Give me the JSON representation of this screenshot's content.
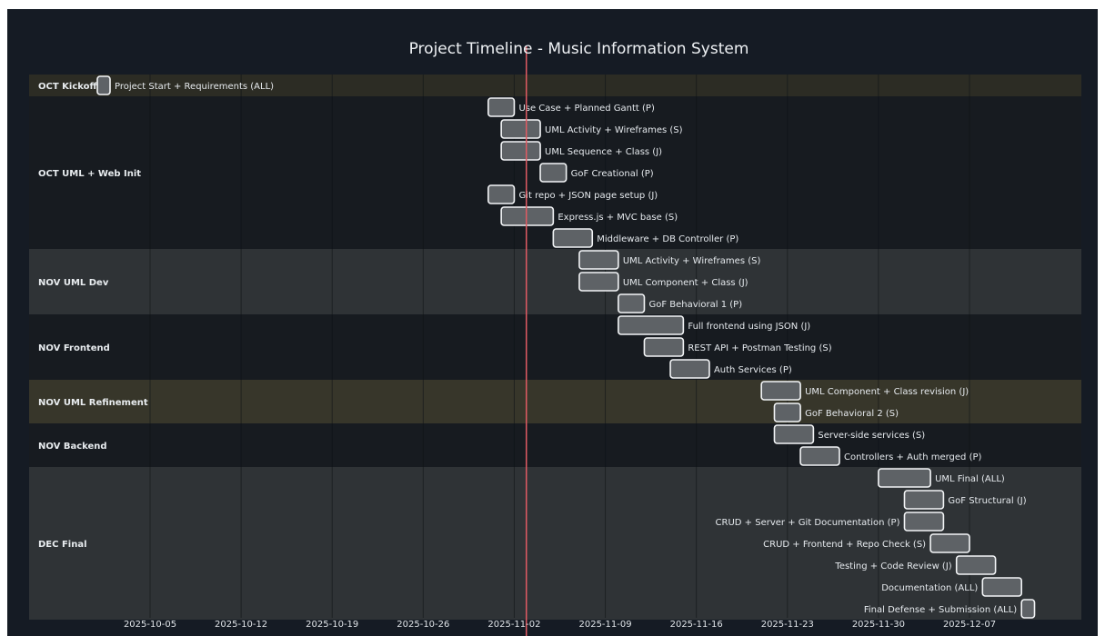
{
  "chart_data": {
    "type": "gantt",
    "title": "Project Timeline - Music Information System",
    "today_marker": "2025-11-03",
    "x_ticks": [
      "2025-10-05",
      "2025-10-12",
      "2025-10-19",
      "2025-10-26",
      "2025-11-02",
      "2025-11-09",
      "2025-11-16",
      "2025-11-23",
      "2025-11-30",
      "2025-12-07"
    ],
    "x_range": [
      "2025-09-30",
      "2025-12-15"
    ],
    "sections": [
      {
        "name": "OCT Kickoff",
        "tasks": [
          {
            "label": "Project Start + Requirements (ALL)",
            "start": "2025-10-01",
            "end": "2025-10-02",
            "label_side": "right"
          }
        ]
      },
      {
        "name": "OCT UML + Web Init",
        "tasks": [
          {
            "label": "Use Case + Planned Gantt (P)",
            "start": "2025-10-31",
            "end": "2025-11-02",
            "label_side": "right"
          },
          {
            "label": "UML Activity + Wireframes (S)",
            "start": "2025-11-01",
            "end": "2025-11-04",
            "label_side": "right"
          },
          {
            "label": "UML Sequence + Class (J)",
            "start": "2025-11-01",
            "end": "2025-11-04",
            "label_side": "right"
          },
          {
            "label": "GoF Creational (P)",
            "start": "2025-11-04",
            "end": "2025-11-06",
            "label_side": "right"
          },
          {
            "label": "Git repo + JSON page setup (J)",
            "start": "2025-10-31",
            "end": "2025-11-02",
            "label_side": "right"
          },
          {
            "label": "Express.js + MVC base (S)",
            "start": "2025-11-01",
            "end": "2025-11-05",
            "label_side": "right"
          },
          {
            "label": "Middleware + DB Controller (P)",
            "start": "2025-11-05",
            "end": "2025-11-08",
            "label_side": "right"
          }
        ]
      },
      {
        "name": "NOV UML Dev",
        "tasks": [
          {
            "label": "UML Activity + Wireframes (S)",
            "start": "2025-11-07",
            "end": "2025-11-10",
            "label_side": "right"
          },
          {
            "label": "UML Component + Class (J)",
            "start": "2025-11-07",
            "end": "2025-11-10",
            "label_side": "right"
          },
          {
            "label": "GoF Behavioral 1 (P)",
            "start": "2025-11-10",
            "end": "2025-11-12",
            "label_side": "right"
          }
        ]
      },
      {
        "name": "NOV Frontend",
        "tasks": [
          {
            "label": "Full frontend using JSON (J)",
            "start": "2025-11-10",
            "end": "2025-11-15",
            "label_side": "right"
          },
          {
            "label": "REST API + Postman Testing (S)",
            "start": "2025-11-12",
            "end": "2025-11-15",
            "label_side": "right"
          },
          {
            "label": "Auth Services (P)",
            "start": "2025-11-14",
            "end": "2025-11-17",
            "label_side": "right"
          }
        ]
      },
      {
        "name": "NOV UML Refinement",
        "tasks": [
          {
            "label": "UML Component + Class revision (J)",
            "start": "2025-11-21",
            "end": "2025-11-24",
            "label_side": "right"
          },
          {
            "label": "GoF Behavioral 2 (S)",
            "start": "2025-11-22",
            "end": "2025-11-24",
            "label_side": "right"
          }
        ]
      },
      {
        "name": "NOV Backend",
        "tasks": [
          {
            "label": "Server-side services (S)",
            "start": "2025-11-22",
            "end": "2025-11-25",
            "label_side": "right"
          },
          {
            "label": "Controllers + Auth merged (P)",
            "start": "2025-11-24",
            "end": "2025-11-27",
            "label_side": "right"
          }
        ]
      },
      {
        "name": "DEC Final",
        "tasks": [
          {
            "label": "UML Final (ALL)",
            "start": "2025-11-30",
            "end": "2025-12-04",
            "label_side": "right"
          },
          {
            "label": "GoF Structural (J)",
            "start": "2025-12-02",
            "end": "2025-12-05",
            "label_side": "right"
          },
          {
            "label": "CRUD + Server + Git Documentation (P)",
            "start": "2025-12-02",
            "end": "2025-12-05",
            "label_side": "left"
          },
          {
            "label": "CRUD + Frontend + Repo Check (S)",
            "start": "2025-12-04",
            "end": "2025-12-07",
            "label_side": "left"
          },
          {
            "label": "Testing + Code Review (J)",
            "start": "2025-12-06",
            "end": "2025-12-09",
            "label_side": "left"
          },
          {
            "label": "Documentation (ALL)",
            "start": "2025-12-08",
            "end": "2025-12-11",
            "label_side": "left"
          },
          {
            "label": "Final Defense + Submission (ALL)",
            "start": "2025-12-11",
            "end": "2025-12-12",
            "label_side": "left"
          }
        ]
      }
    ],
    "colors": {
      "frame_bg": "#151b24",
      "band_even": "#2f3336",
      "band_odd": "#171b20",
      "band_highlight": "#37362a",
      "band_kickoff": "#2c2c24",
      "bar_fill": "#5e6266",
      "bar_stroke": "#f3f5f7",
      "today_line": "#e05b63",
      "grid": "#0d1115",
      "text": "#e6eaee"
    }
  }
}
